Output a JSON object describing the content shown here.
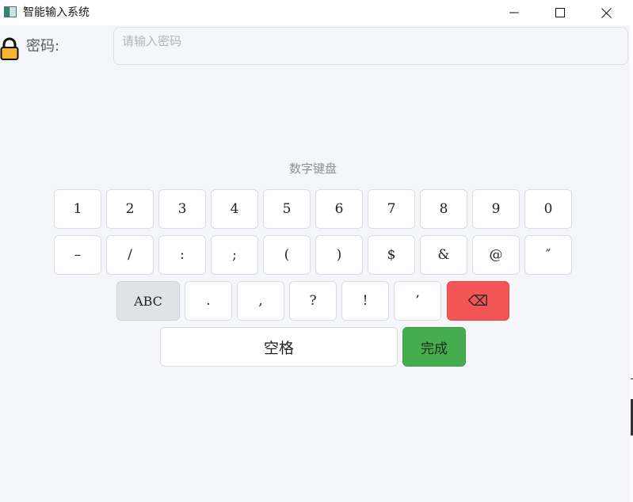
{
  "window": {
    "title": "智能输入系统",
    "icons": [
      "app-icon",
      "minimize-icon",
      "maximize-icon",
      "close-icon"
    ]
  },
  "password": {
    "label": "密码:",
    "placeholder": "请输入密码",
    "value": "",
    "icon": "lock-icon"
  },
  "keyboard": {
    "title": "数字键盘",
    "row1": [
      "1",
      "2",
      "3",
      "4",
      "5",
      "6",
      "7",
      "8",
      "9",
      "0"
    ],
    "row2": [
      "–",
      "/",
      ":",
      ";",
      "(",
      ")",
      "$",
      "&",
      "@",
      "″"
    ],
    "row3": {
      "abc_label": "ABC",
      "keys": [
        ".",
        ",",
        "?",
        "!",
        "’"
      ],
      "backspace_icon": "backspace-icon",
      "backspace_glyph": "⌫"
    },
    "row4": {
      "space_label": "空格",
      "done_label": "完成"
    }
  },
  "colors": {
    "backspace": "#f25555",
    "done": "#46ad4e",
    "abc": "#dfe2e7",
    "lock_body": "#f5b52e"
  }
}
